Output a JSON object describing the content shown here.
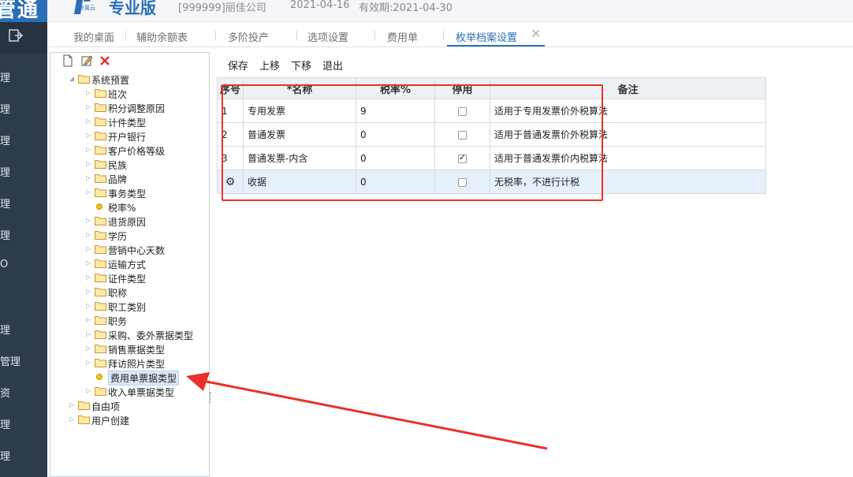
{
  "header": {
    "logo_text": "管通",
    "brand_sub": "专属云",
    "brand_name": "专业版",
    "company": "[999999]丽佳公司",
    "date": "2021-04-16",
    "expiry": "有效期:2021-04-30"
  },
  "tabs": [
    {
      "label": "我的桌面"
    },
    {
      "label": "辅助余额表"
    },
    {
      "label": "多阶投产"
    },
    {
      "label": "选项设置"
    },
    {
      "label": "费用单"
    },
    {
      "label": "枚举档案设置"
    }
  ],
  "leftnav": {
    "items": [
      "理",
      "理",
      "理",
      "理",
      "理",
      "理",
      "O",
      "理",
      "管理",
      "资",
      "理",
      "理"
    ]
  },
  "tree": {
    "root": "系统预置",
    "children": [
      "班次",
      "积分调整原因",
      "计件类型",
      "开户银行",
      "客户价格等级",
      "民族",
      "品牌",
      "事务类型",
      "税率%",
      "退货原因",
      "学历",
      "营销中心天数",
      "运输方式",
      "证件类型",
      "职称",
      "职工类别",
      "职务",
      "采购、委外票据类型",
      "销售票据类型",
      "拜访照片类型",
      "费用单票据类型",
      "收入单票据类型"
    ],
    "bottom": [
      "自由项",
      "用户创建"
    ]
  },
  "toolbar": {
    "save": "保存",
    "up": "上移",
    "down": "下移",
    "exit": "退出"
  },
  "grid": {
    "headers": [
      "序号",
      "*名称",
      "税率%",
      "停用",
      "备注"
    ],
    "rows": [
      {
        "no": "1",
        "name": "专用发票",
        "rate": "9",
        "disabled": false,
        "note": "适用于专用发票价外税算法"
      },
      {
        "no": "2",
        "name": "普通发票",
        "rate": "0",
        "disabled": false,
        "note": "适用于普通发票价外税算法"
      },
      {
        "no": "3",
        "name": "普通发票-内含",
        "rate": "0",
        "disabled": true,
        "note": "适用于普通发票价内税算法"
      },
      {
        "no": "",
        "name": "收据",
        "rate": "0",
        "disabled": false,
        "note": "无税率，不进行计税"
      }
    ]
  },
  "colors": {
    "brand": "#2a6fb7",
    "nav": "#2e3b4a",
    "annotation": "#e8322a"
  }
}
